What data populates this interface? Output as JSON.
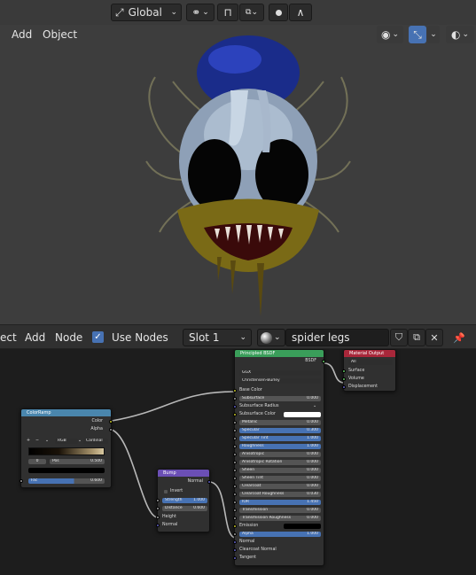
{
  "viewport": {
    "menu": [
      "Add",
      "Object"
    ],
    "orientation": "Global",
    "snap_glyph": "⊓",
    "proportional_label": "Ⅎ",
    "falloff_glyph": "∧"
  },
  "node_header": {
    "items": [
      "ect",
      "Add",
      "Node"
    ],
    "use_nodes_label": "Use Nodes",
    "slot": "Slot 1",
    "material_name": "spider legs"
  },
  "colorramp": {
    "title": "ColorRamp",
    "out": [
      "Color",
      "Alpha"
    ],
    "controls": [
      "+",
      "−",
      "⌄",
      "RGB",
      "⌄",
      "Cardinal"
    ],
    "index": "0",
    "pos_label": "Pos",
    "pos_value": "0.500",
    "fac_label": "Fac",
    "fac_value": "0.600"
  },
  "bump": {
    "title": "Bump",
    "out": "Normal",
    "invert": "Invert",
    "strength_label": "Strength",
    "strength_value": "1.000",
    "distance_label": "Distance",
    "distance_value": "0.600",
    "inputs": [
      "Height",
      "Normal"
    ]
  },
  "bsdf": {
    "title": "Principled BSDF",
    "out": "BSDF",
    "dist": "GGX",
    "sss": "Christensen-Burley",
    "rows": [
      [
        "Base Color",
        ""
      ],
      [
        "Subsurface",
        "0.000"
      ],
      [
        "Subsurface Radius",
        ""
      ],
      [
        "Subsurface Color",
        ""
      ],
      [
        "Metallic",
        "0.000"
      ],
      [
        "Specular",
        "0.300"
      ],
      [
        "Specular Tint",
        "1.000"
      ],
      [
        "Roughness",
        "1.000"
      ],
      [
        "Anisotropic",
        "0.000"
      ],
      [
        "Anisotropic Rotation",
        "0.000"
      ],
      [
        "Sheen",
        "0.000"
      ],
      [
        "Sheen Tint",
        "0.000"
      ],
      [
        "Clearcoat",
        "0.000"
      ],
      [
        "Clearcoat Roughness",
        "0.030"
      ],
      [
        "IOR",
        "1.450"
      ],
      [
        "Transmission",
        "0.000"
      ],
      [
        "Transmission Roughness",
        "0.000"
      ],
      [
        "Emission",
        ""
      ],
      [
        "Alpha",
        "1.000"
      ],
      [
        "Normal",
        ""
      ],
      [
        "Clearcoat Normal",
        ""
      ],
      [
        "Tangent",
        ""
      ]
    ]
  },
  "output": {
    "title": "Material Output",
    "target": "All",
    "inputs": [
      "Surface",
      "Volume",
      "Displacement"
    ]
  },
  "colors": {
    "accent": "#4772b3",
    "shader_header": "#3a9e5a",
    "output_header": "#a8273a",
    "input_header": "#4a86ad",
    "vector_header": "#6b4fb5"
  }
}
